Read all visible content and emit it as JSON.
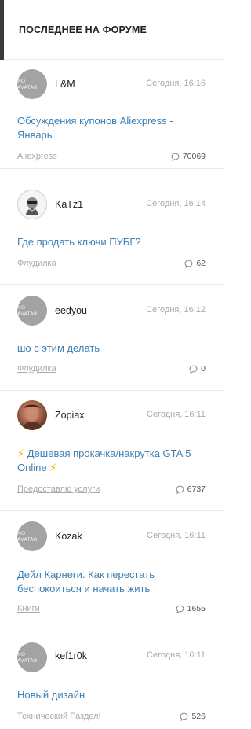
{
  "header": {
    "title": "ПОСЛЕДНЕЕ НА ФОРУМЕ"
  },
  "no_avatar_text": "NO AVATAR",
  "topics": [
    {
      "user": "L&M",
      "time": "Сегодня, 16:16",
      "title": "Обсуждения купонов Aliexpress - Январь",
      "category": "Aliexpress",
      "replies": "70069",
      "avatar": "no-avatar"
    },
    {
      "user": "KaTz1",
      "time": "Сегодня, 16:14",
      "title": "Где продать ключи ПУБГ?",
      "category": "Флудилка",
      "replies": "62",
      "avatar": "photo"
    },
    {
      "user": "eedyou",
      "time": "Сегодня, 16:12",
      "title": "шо с этим делать",
      "category": "Флудилка",
      "replies": "0",
      "avatar": "no-avatar"
    },
    {
      "user": "Zopiax",
      "time": "Сегодня, 16:11",
      "title": "Дешевая прокачка/накрутка GTA 5 Online",
      "category": "Предоставлю услуги",
      "replies": "6737",
      "avatar": "photo"
    },
    {
      "user": "Kozak",
      "time": "Сегодня, 16:11",
      "title": "Дейл Карнеги. Как перестать беспокоиться и начать жить",
      "category": "Книги",
      "replies": "1655",
      "avatar": "no-avatar"
    },
    {
      "user": "kef1r0k",
      "time": "Сегодня, 16:11",
      "title": "Новый дизайн",
      "category": "Технический Раздел!",
      "replies": "526",
      "avatar": "no-avatar"
    }
  ],
  "colors": {
    "link": "#3d7fb3",
    "muted": "#a9a9a9",
    "accent_bar": "#3a3a3a",
    "bolt": "#f0b400"
  }
}
